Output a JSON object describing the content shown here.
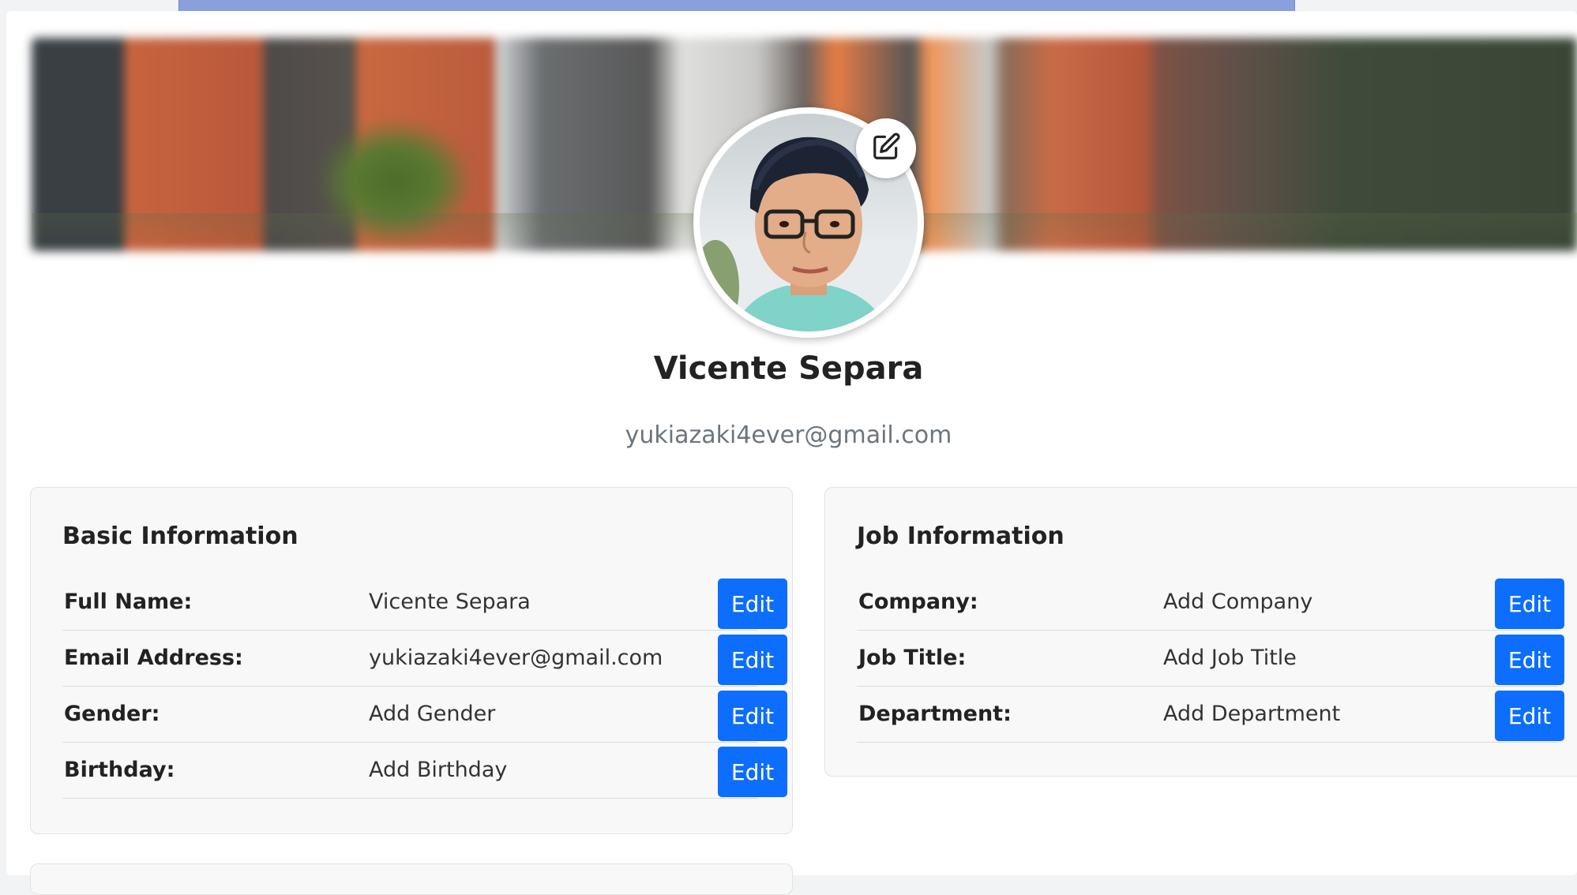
{
  "profile": {
    "name": "Vicente Separa",
    "email": "yukiazaki4ever@gmail.com",
    "avatar_edit_icon": "pencil-square-icon"
  },
  "basic_info": {
    "title": "Basic Information",
    "rows": [
      {
        "label": "Full Name:",
        "value": "Vicente Separa",
        "button": "Edit"
      },
      {
        "label": "Email Address:",
        "value": "yukiazaki4ever@gmail.com",
        "button": "Edit"
      },
      {
        "label": "Gender:",
        "value": "Add Gender",
        "button": "Edit"
      },
      {
        "label": "Birthday:",
        "value": "Add Birthday",
        "button": "Edit"
      }
    ]
  },
  "job_info": {
    "title": "Job Information",
    "rows": [
      {
        "label": "Company:",
        "value": "Add Company",
        "button": "Edit"
      },
      {
        "label": "Job Title:",
        "value": "Add Job Title",
        "button": "Edit"
      },
      {
        "label": "Department:",
        "value": "Add Department",
        "button": "Edit"
      }
    ]
  },
  "colors": {
    "accent": "#0d6efd",
    "top_bar": "#8aa0dc",
    "muted_text": "#6c757d"
  }
}
